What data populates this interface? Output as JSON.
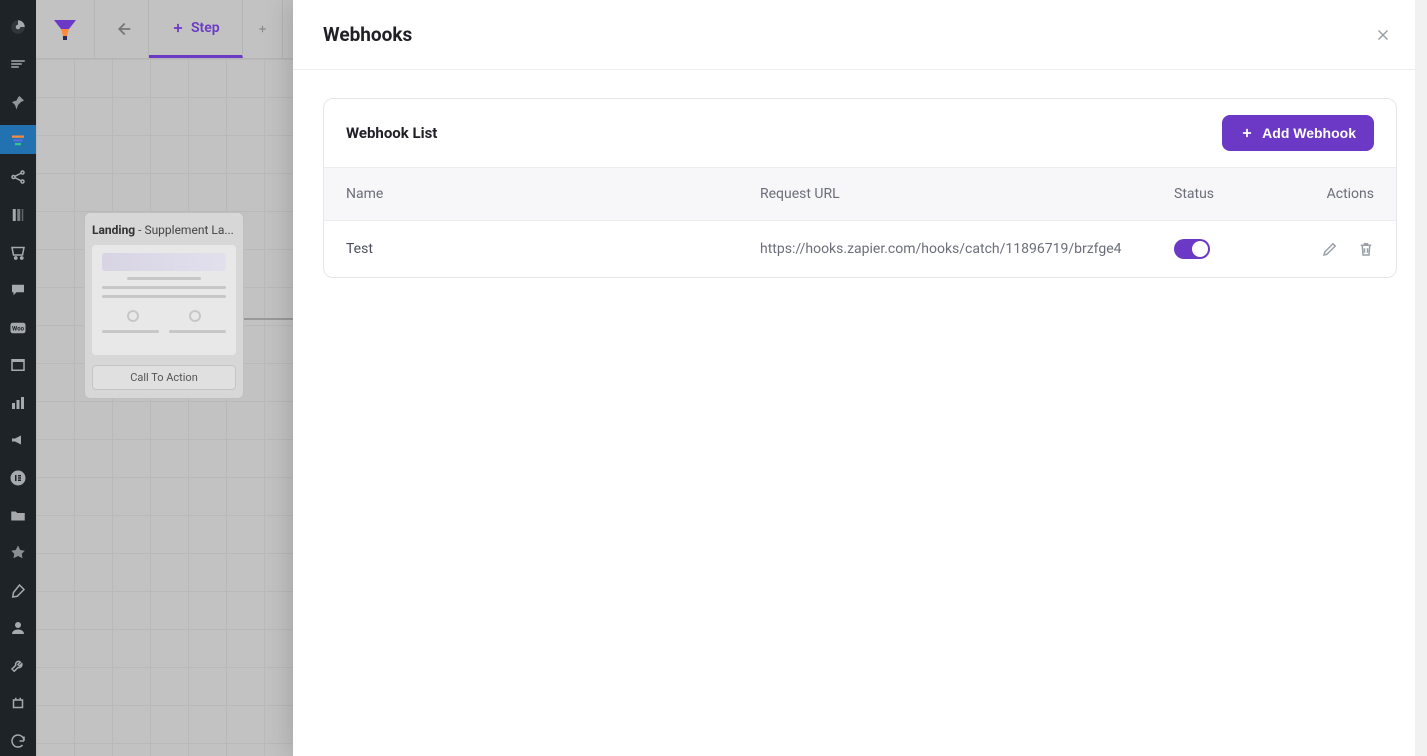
{
  "colors": {
    "accent": "#6b39c6",
    "admin_bg": "#1d2327",
    "admin_active": "#2271b1"
  },
  "toolbar": {
    "step_label": "Step"
  },
  "canvas_node": {
    "type_label": "Landing",
    "name": "Supplement La...",
    "cta_label": "Call To Action"
  },
  "drawer": {
    "title": "Webhooks",
    "card_title": "Webhook List",
    "add_button_label": "Add Webhook",
    "columns": {
      "name": "Name",
      "url": "Request URL",
      "status": "Status",
      "actions": "Actions"
    },
    "rows": [
      {
        "name": "Test",
        "url": "https://hooks.zapier.com/hooks/catch/11896719/brzfge4",
        "status_on": true
      }
    ]
  }
}
